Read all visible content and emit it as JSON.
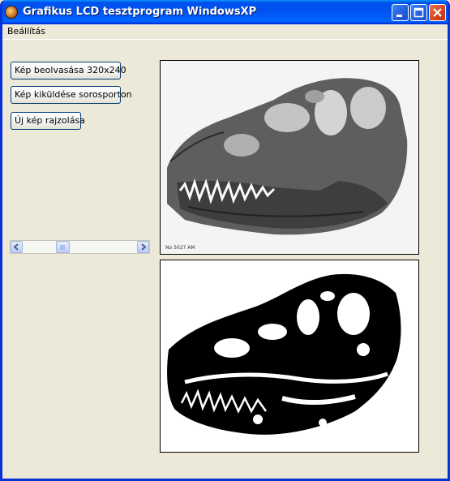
{
  "window": {
    "title": "Grafikus LCD tesztprogram WindowsXP",
    "accent": "#0053ee",
    "close_color": "#d8461f"
  },
  "menu": {
    "items": [
      "Beállítás"
    ]
  },
  "buttons": {
    "load": "Kép beolvasása 320x240",
    "send": "Kép kiküldése sorosporton",
    "draw": "Új kép rajzolása"
  },
  "scrollbar": {
    "value_fraction": 0.33
  },
  "images": {
    "original": {
      "icon": "t-rex-skull-photo",
      "caption": "No 5027 AM"
    },
    "converted": {
      "icon": "t-rex-skull-monochrome"
    }
  }
}
